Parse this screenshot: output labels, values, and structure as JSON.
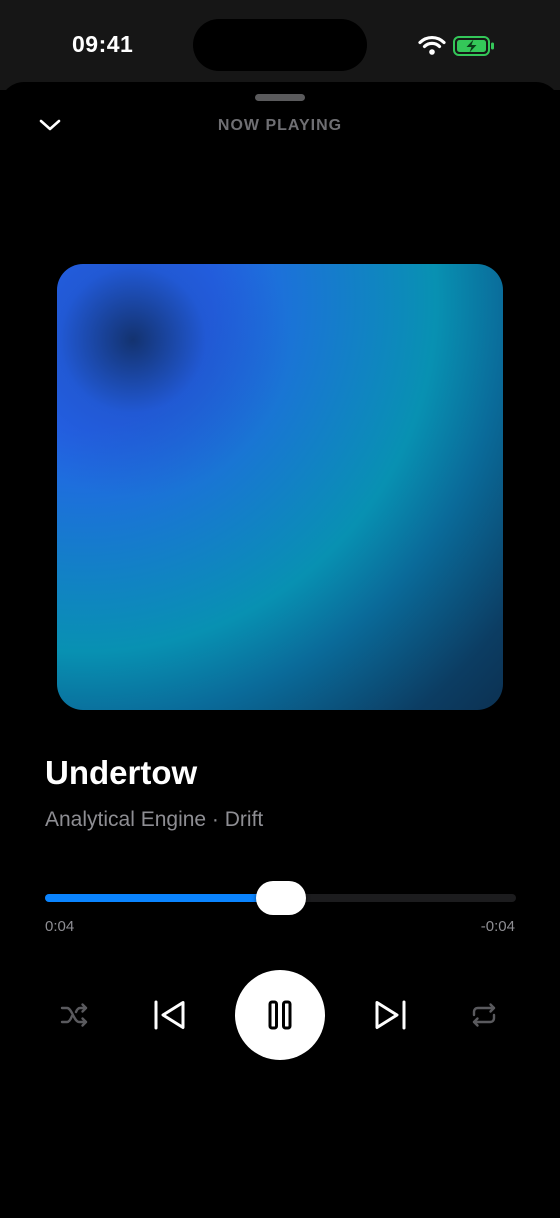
{
  "status_bar": {
    "time": "09:41",
    "wifi_icon": "wifi-icon",
    "battery_icon": "battery-charging-icon",
    "battery_color": "#34c759"
  },
  "header": {
    "title": "NOW PLAYING",
    "collapse_icon": "chevron-down-icon"
  },
  "artwork": {
    "colors": [
      "#2563eb",
      "#0891b2",
      "#0c3152"
    ]
  },
  "track": {
    "title": "Undertow",
    "subtitle": "Analytical Engine · Drift"
  },
  "progress": {
    "elapsed": "0:04",
    "remaining": "-0:04",
    "fraction": 0.5,
    "accent_color": "#0a84ff"
  },
  "controls": {
    "shuffle_icon": "shuffle-icon",
    "previous_icon": "skip-previous-icon",
    "play_pause_icon": "pause-icon",
    "next_icon": "skip-next-icon",
    "repeat_icon": "repeat-icon"
  }
}
